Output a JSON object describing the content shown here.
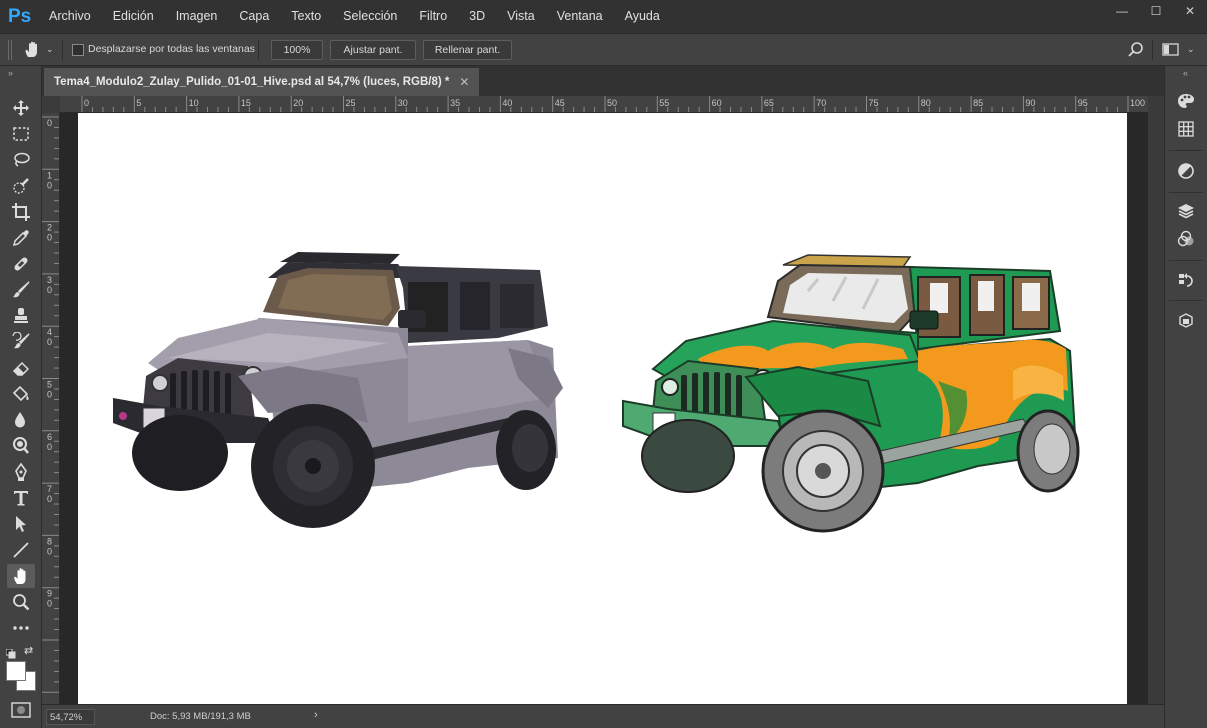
{
  "app": {
    "logo": "Ps"
  },
  "menu": [
    "Archivo",
    "Edición",
    "Imagen",
    "Capa",
    "Texto",
    "Selección",
    "Filtro",
    "3D",
    "Vista",
    "Ventana",
    "Ayuda"
  ],
  "window_controls": {
    "minimize": "—",
    "maximize": "☐",
    "close": "✕"
  },
  "options": {
    "scroll_all_label": "Desplazarse por todas las ventanas",
    "zoom_100": "100%",
    "fit_screen": "Ajustar pant.",
    "fill_screen": "Rellenar pant."
  },
  "document": {
    "tab_title": "Tema4_Modulo2_Zulay_Pulido_01-01_Hive.psd al 54,7% (luces, RGB/8) *",
    "tab_close": "✕"
  },
  "ruler": {
    "h_labels": [
      "0",
      "5",
      "10",
      "15",
      "20",
      "25",
      "30",
      "35",
      "40",
      "45",
      "50",
      "55",
      "60",
      "65",
      "70",
      "75",
      "80",
      "85",
      "90",
      "95",
      "100"
    ],
    "v_labels": [
      "0",
      "1\n0",
      "2\n0",
      "3\n0",
      "4\n0",
      "5\n0",
      "6\n0",
      "7\n0",
      "8\n0",
      "9\n0"
    ]
  },
  "status": {
    "zoom": "54,72%",
    "doc_info": "Doc: 5,93 MB/191,3 MB",
    "arrow": "›"
  },
  "canvas_content": {
    "left_image": "gray-jeep-photo",
    "right_image": "green-orange-illustrated-jeep"
  },
  "colors": {
    "ps_blue": "#31a8ff",
    "jeep_gray": "#8d8894",
    "jeep_green": "#1f9a52",
    "jeep_orange": "#f39a1e",
    "foreground": "#ffffff",
    "background": "#ffffff"
  }
}
